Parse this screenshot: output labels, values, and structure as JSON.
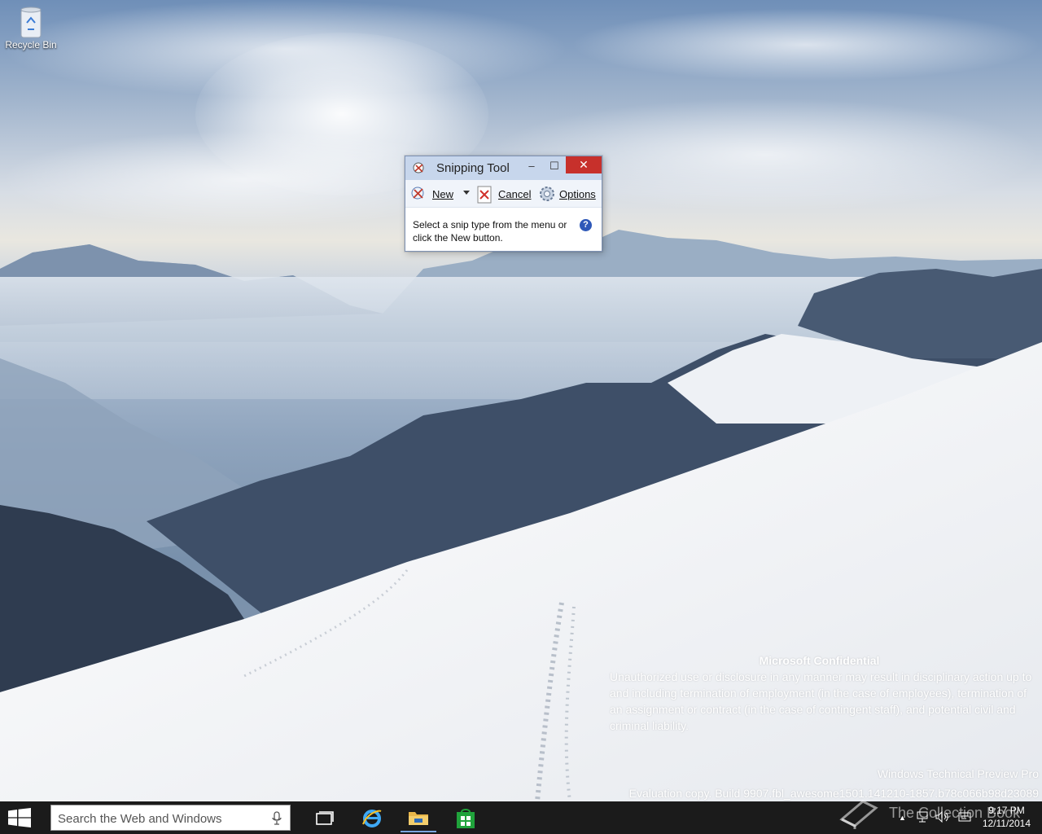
{
  "desktop": {
    "recycle_bin_label": "Recycle Bin"
  },
  "snipping_tool": {
    "title": "Snipping Tool",
    "minimize_glyph": "–",
    "maximize_glyph": "☐",
    "close_glyph": "✕",
    "new_label": "New",
    "cancel_label": "Cancel",
    "options_label": "Options",
    "message": "Select a snip type from the menu or click the New button.",
    "help_glyph": "?"
  },
  "watermark": {
    "confidential_title": "Microsoft Confidential",
    "confidential_body": "Unauthorized use or disclosure in any manner may result in disciplinary action up to and including termination of employment (in the case of employees), termination of an assignment or contract (in the case of contingent staff), and potential civil and criminal liability.",
    "edition": "Windows Technical Preview Pro",
    "build": "Evaluation copy. Build 9907.fbl_awesome1501.141210-1857.b78c066b98d23089",
    "collection_book": "The Collection Book"
  },
  "taskbar": {
    "search_placeholder": "Search the Web and Windows",
    "apps": [
      "task-view",
      "internet-explorer",
      "file-explorer",
      "store"
    ],
    "time": "9:17 PM",
    "date": "12/11/2014",
    "tray_expand_glyph": "▲"
  },
  "colors": {
    "taskbar": "#1b1b1b",
    "close_button": "#c7302b",
    "titlebar": "#c7d6ec",
    "active_indicator": "#7aa7e0"
  }
}
